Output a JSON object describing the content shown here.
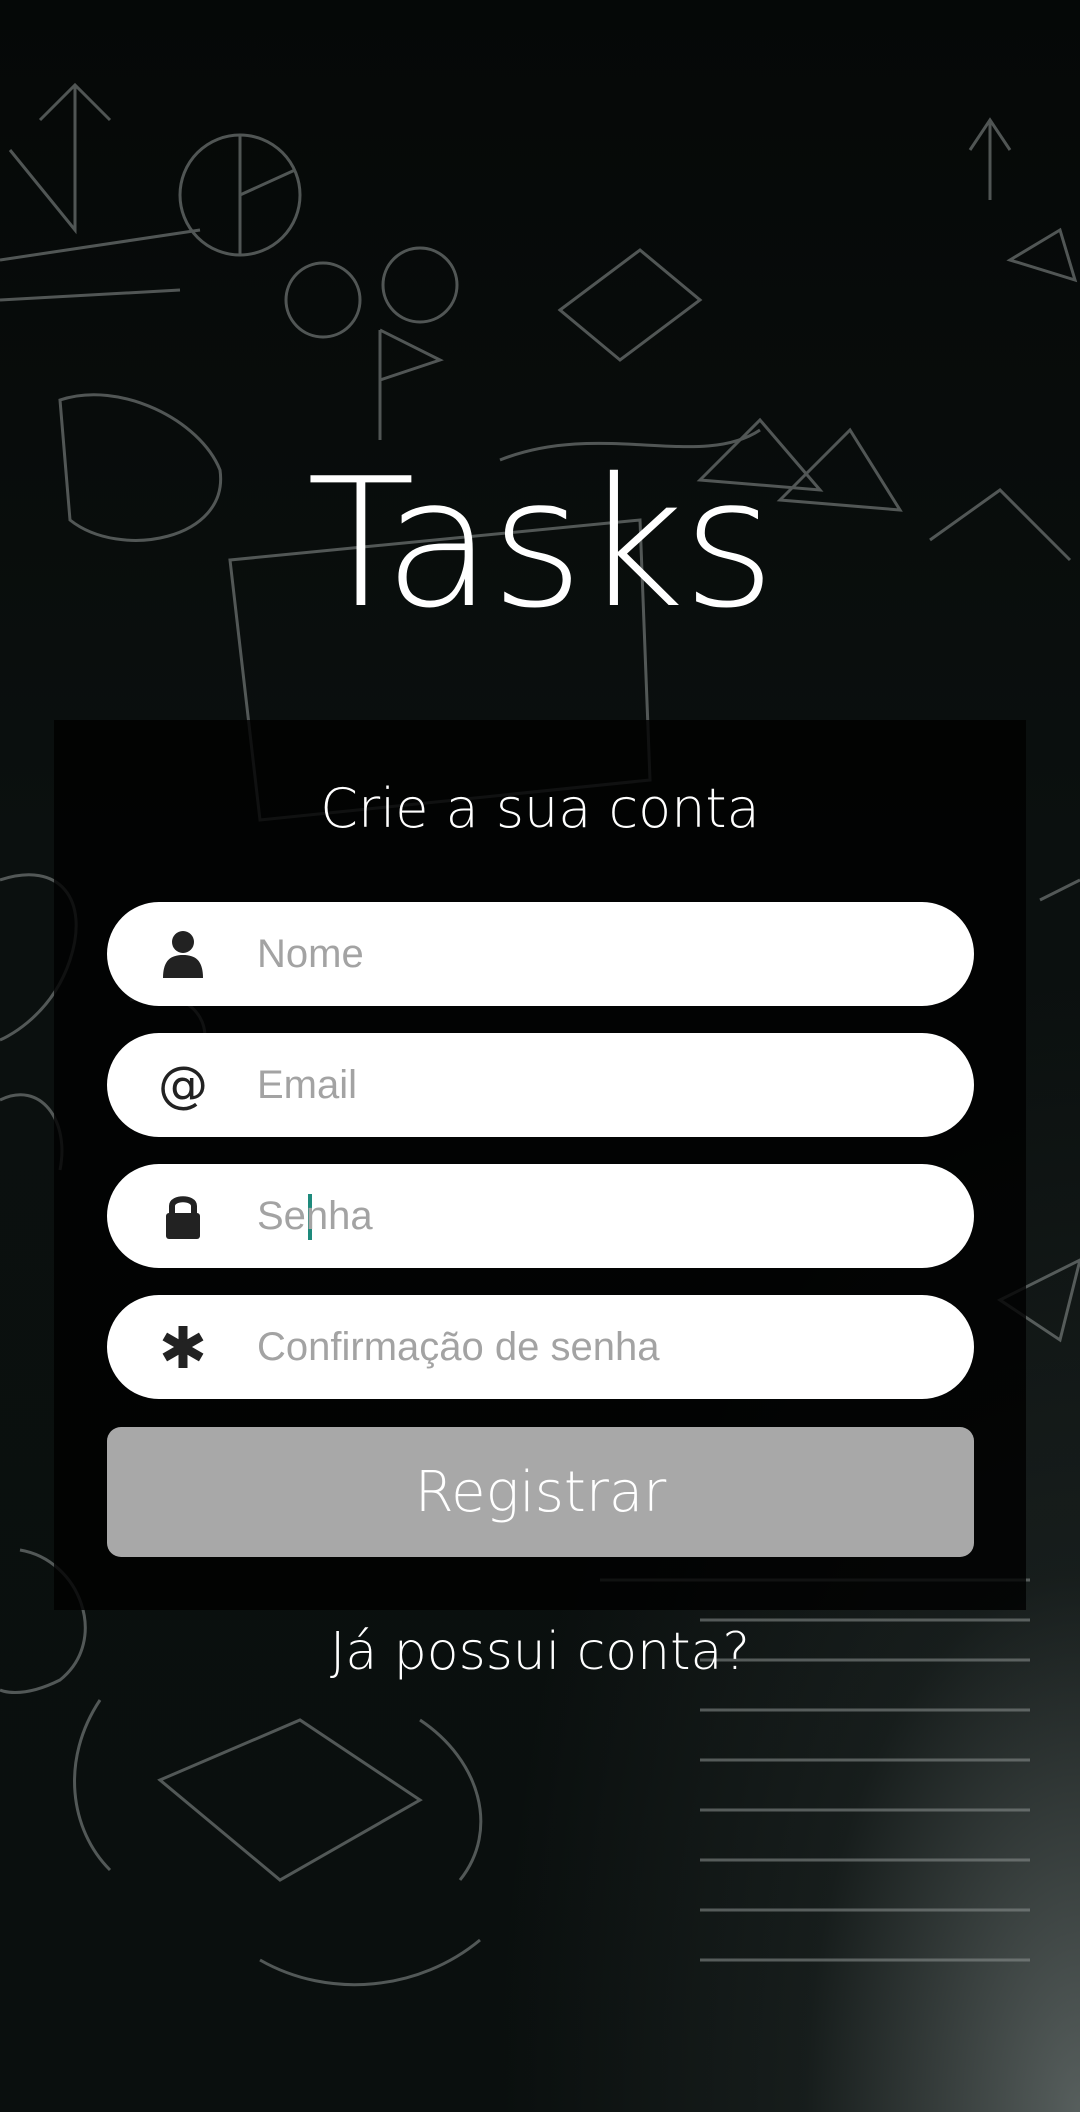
{
  "app": {
    "title": "Tasks"
  },
  "form": {
    "heading": "Crie a sua conta",
    "fields": [
      {
        "icon": "user-icon",
        "placeholder": "Nome",
        "value": ""
      },
      {
        "icon": "at-sign-icon",
        "icon_glyph": "@",
        "placeholder": "Email",
        "value": ""
      },
      {
        "icon": "lock-icon",
        "placeholder": "Senha",
        "value": ""
      },
      {
        "icon": "asterisk-icon",
        "placeholder": "Confirmação de senha",
        "value": ""
      }
    ],
    "submit_label": "Registrar"
  },
  "footer": {
    "login_link": "Já possui conta?"
  },
  "colors": {
    "panel_background": "#000000",
    "field_background": "#ffffff",
    "button_background": "#a8a8a8",
    "cursor": "#1e8a7c",
    "text": "#ffffff"
  }
}
